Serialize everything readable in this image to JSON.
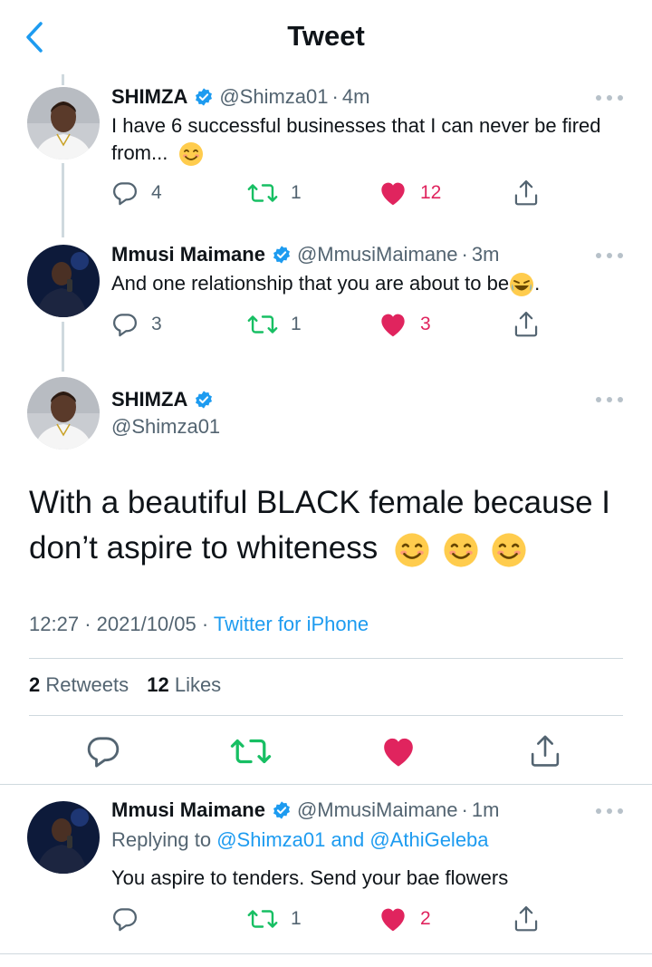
{
  "header": {
    "title": "Tweet"
  },
  "tweets_above": [
    {
      "name": "SHIMZA",
      "handle": "@Shimza01",
      "time": "4m",
      "text": "I have 6 successful businesses that I can never be fired from...",
      "replies": "4",
      "retweets": "1",
      "likes": "12"
    },
    {
      "name": "Mmusi Maimane",
      "handle": "@MmusiMaimane",
      "time": "3m",
      "text": "And one relationship that you are about to be",
      "text_end": ".",
      "replies": "3",
      "retweets": "1",
      "likes": "3"
    }
  ],
  "main_tweet": {
    "name": "SHIMZA",
    "handle": "@Shimza01",
    "text_line1": "With a beautiful BLACK female because I",
    "text_line2": "don’t aspire to whiteness",
    "time": "12:27",
    "date": "2021/10/05",
    "source": "Twitter for iPhone",
    "retweet_count": "2",
    "retweet_label": "Retweets",
    "like_count": "12",
    "like_label": "Likes"
  },
  "reply": {
    "name": "Mmusi Maimane",
    "handle": "@MmusiMaimane",
    "time": "1m",
    "replying_prefix": "Replying to",
    "mention1": "@Shimza01",
    "and_word": "and",
    "mention2": "@AthiGeleba",
    "text": "You aspire to tenders. Send your bae flowers",
    "retweets": "1",
    "likes": "2"
  },
  "colors": {
    "accent": "#1d9bf0",
    "retweet": "#17bf63",
    "like": "#e0245e",
    "secondary_text": "#536471"
  },
  "icons": [
    "chevron-left-icon",
    "verified-badge-icon",
    "more-icon",
    "reply-icon",
    "retweet-icon",
    "heart-icon",
    "share-icon",
    "smile-emoji-icon",
    "laugh-emoji-icon"
  ]
}
